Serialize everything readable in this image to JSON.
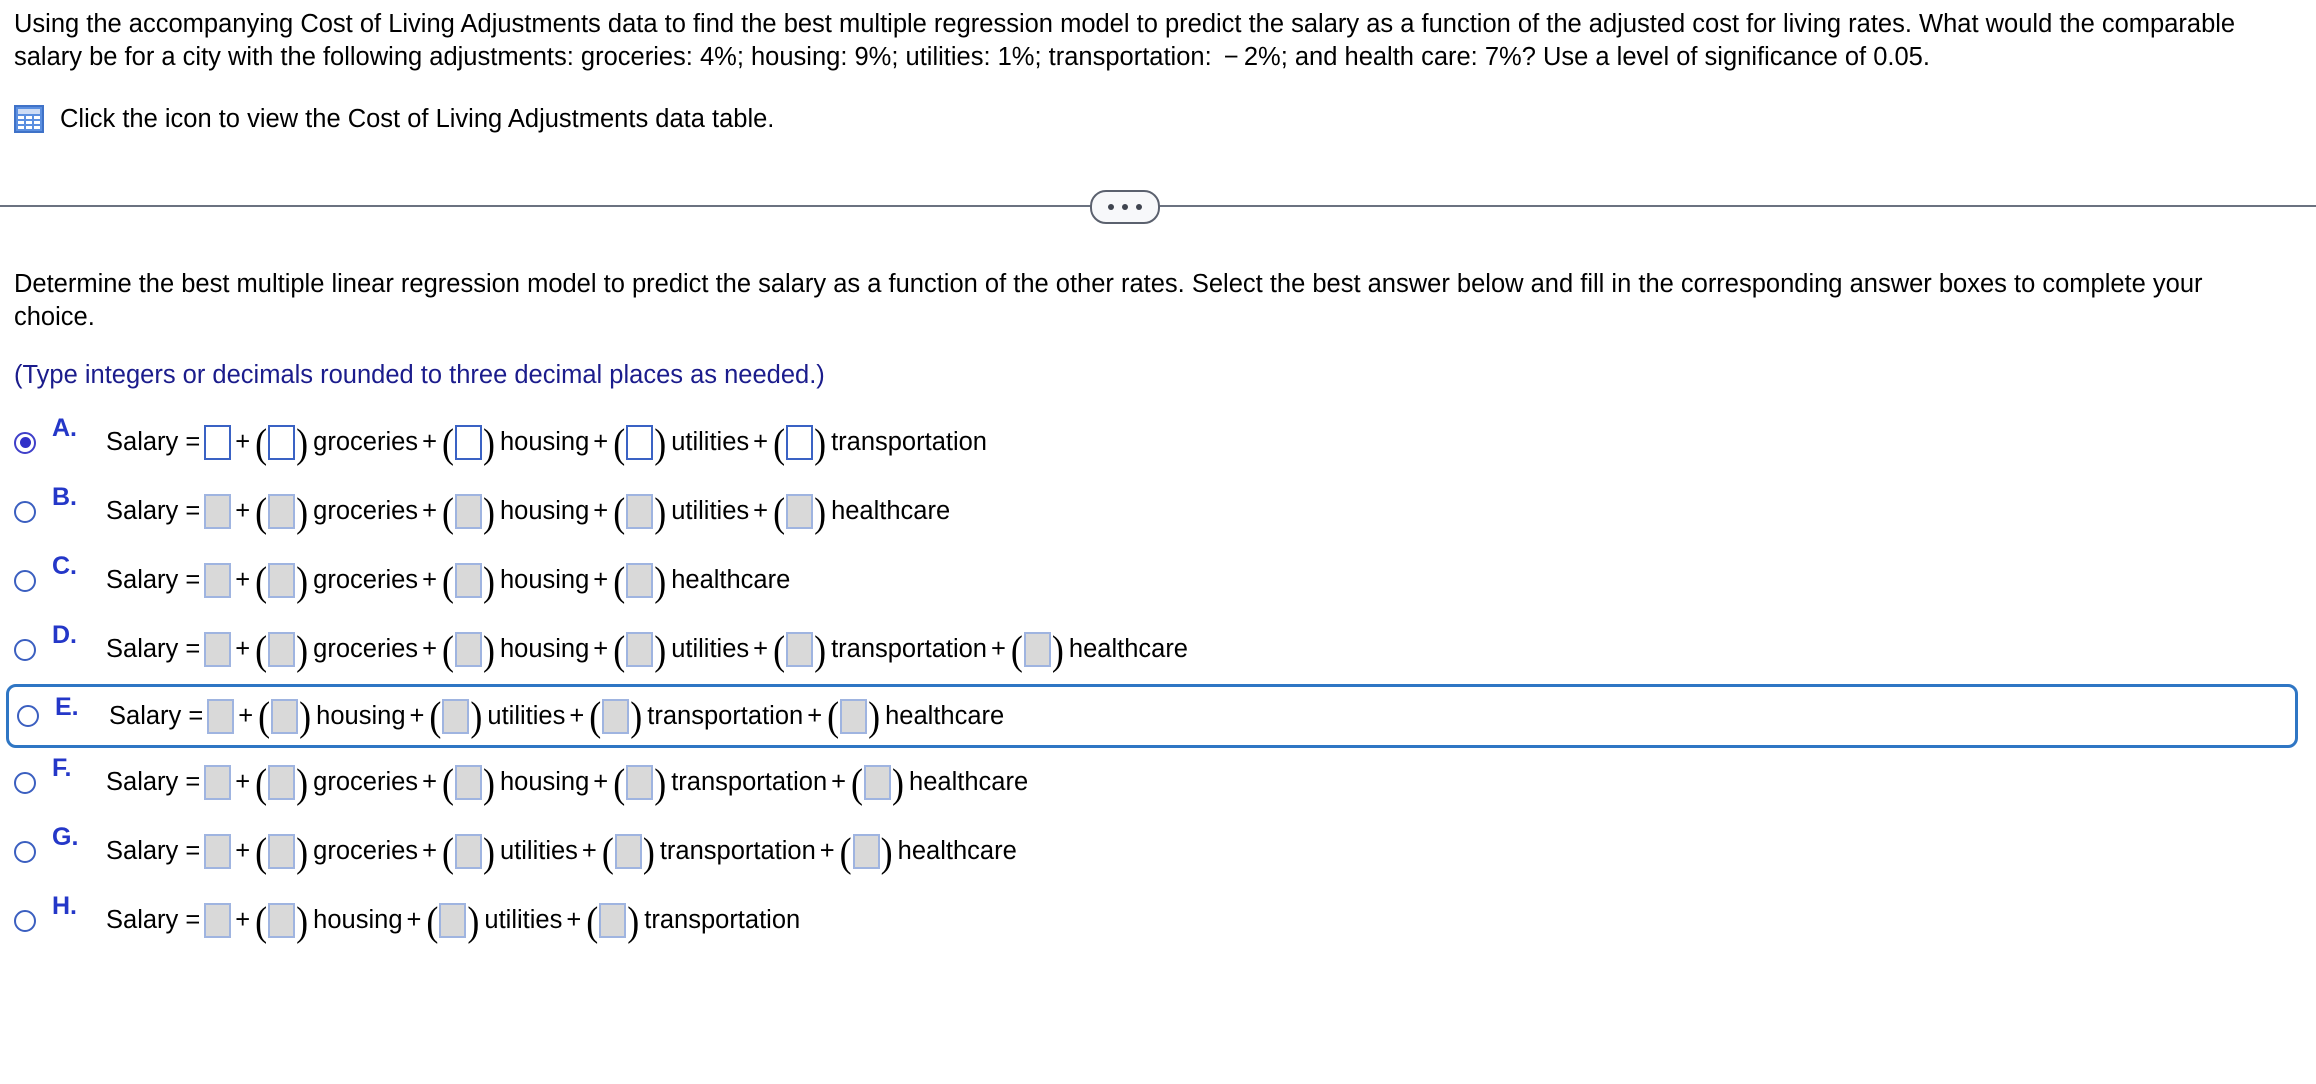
{
  "prompt": {
    "text": "Using the accompanying Cost of Living Adjustments data to find the best multiple regression model to predict the salary as a function of the adjusted cost for living rates. What would the comparable salary be for a city with the following adjustments: groceries: 4%; housing: 9%; utilities: 1%; transportation:  − 2%; and health care: 7%? Use a level of significance of 0.05."
  },
  "data_table_link": {
    "icon": "table-grid-icon",
    "text": "Click the icon to view the Cost of Living Adjustments data table."
  },
  "divider": {
    "dots_label": "•••"
  },
  "question": {
    "text": "Determine the best multiple linear regression model to predict the salary as a function of the other rates. Select the best answer below and fill in the corresponding answer boxes to complete your choice.",
    "hint": "(Type integers or decimals rounded to three decimal places as needed.)"
  },
  "colors": {
    "option_letter": "#2437c8",
    "hint_text": "#1b1c8c",
    "focus_border": "#2f76c4",
    "selected_box_border": "#3a62c4",
    "unselected_box_fill": "#d9d9d9",
    "unselected_box_border": "#9fb4e0",
    "table_icon": "#5b8fe0",
    "divider_line": "#6b7280"
  },
  "options": [
    {
      "letter": "A.",
      "selected": true,
      "focused": false,
      "lead": "Salary =",
      "terms": [
        "groceries",
        "housing",
        "utilities",
        "transportation"
      ]
    },
    {
      "letter": "B.",
      "selected": false,
      "focused": false,
      "lead": "Salary =",
      "terms": [
        "groceries",
        "housing",
        "utilities",
        "healthcare"
      ]
    },
    {
      "letter": "C.",
      "selected": false,
      "focused": false,
      "lead": "Salary =",
      "terms": [
        "groceries",
        "housing",
        "healthcare"
      ]
    },
    {
      "letter": "D.",
      "selected": false,
      "focused": false,
      "lead": "Salary =",
      "terms": [
        "groceries",
        "housing",
        "utilities",
        "transportation",
        "healthcare"
      ]
    },
    {
      "letter": "E.",
      "selected": false,
      "focused": true,
      "lead": "Salary =",
      "terms": [
        "housing",
        "utilities",
        "transportation",
        "healthcare"
      ]
    },
    {
      "letter": "F.",
      "selected": false,
      "focused": false,
      "lead": "Salary =",
      "terms": [
        "groceries",
        "housing",
        "transportation",
        "healthcare"
      ]
    },
    {
      "letter": "G.",
      "selected": false,
      "focused": false,
      "lead": "Salary =",
      "terms": [
        "groceries",
        "utilities",
        "transportation",
        "healthcare"
      ]
    },
    {
      "letter": "H.",
      "selected": false,
      "focused": false,
      "lead": "Salary =",
      "terms": [
        "housing",
        "utilities",
        "transportation"
      ]
    }
  ],
  "symbols": {
    "plus": "+",
    "paren_open": "(",
    "paren_close": ")"
  }
}
